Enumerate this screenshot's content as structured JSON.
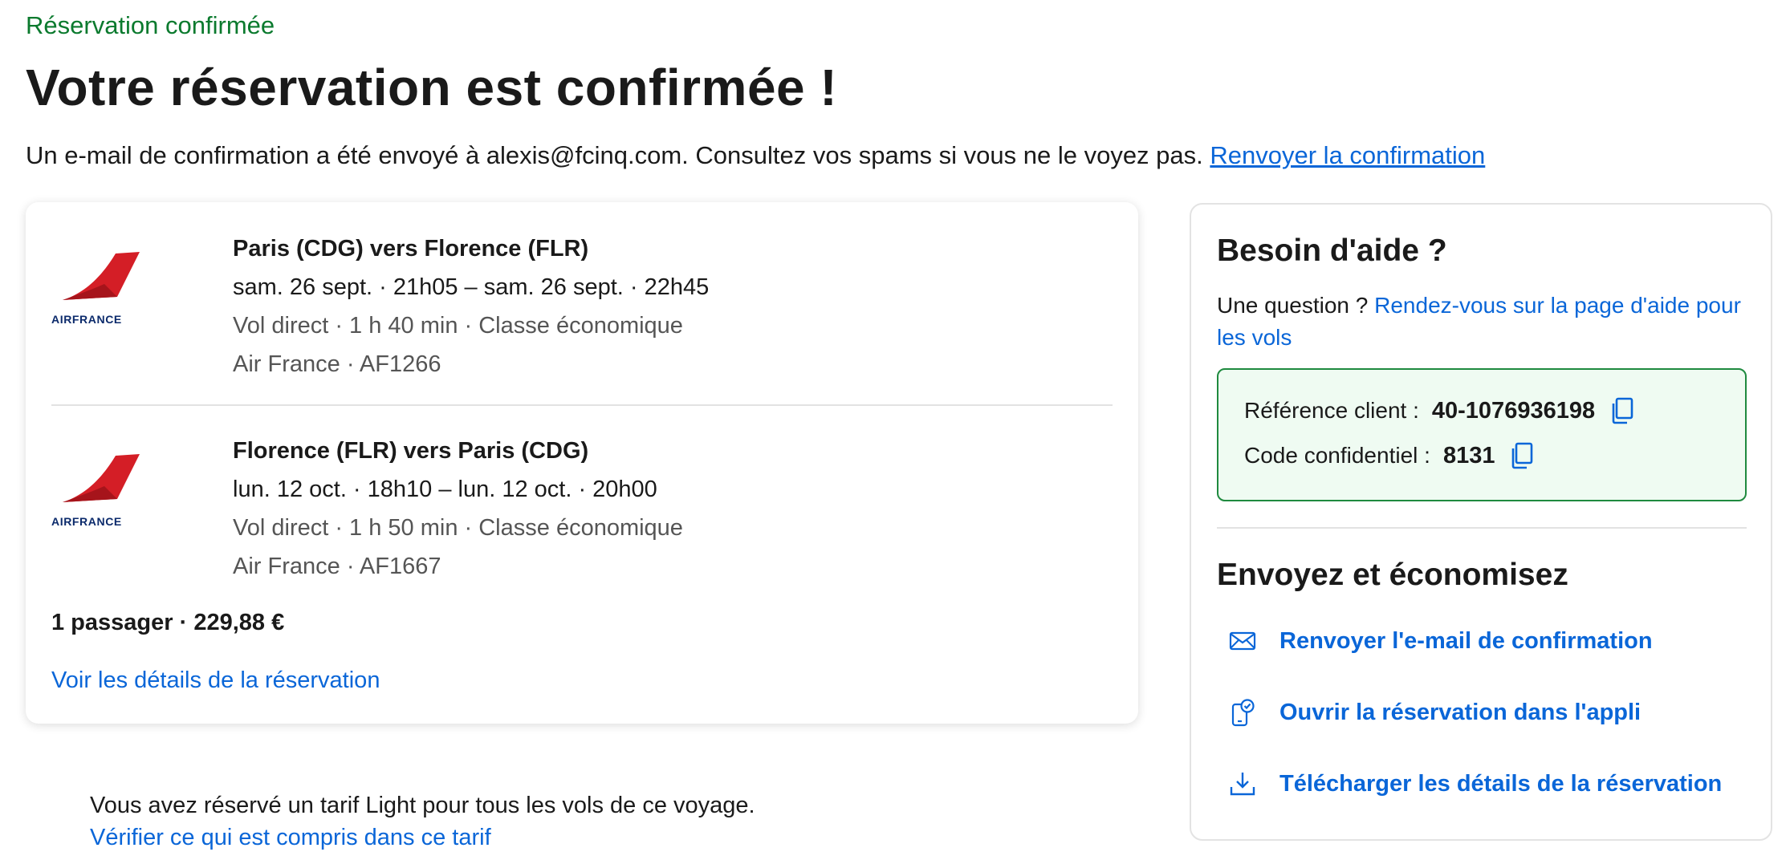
{
  "status": "Réservation confirmée",
  "title": "Votre réservation est confirmée !",
  "subtitle": {
    "text": "Un e-mail de confirmation a été envoyé à alexis@fcinq.com. Consultez vos spams si vous ne le voyez pas.",
    "link": "Renvoyer la confirmation"
  },
  "flights": [
    {
      "airline_logo": "AIRFRANCE",
      "route": "Paris (CDG) vers Florence (FLR)",
      "times": "sam. 26 sept. · 21h05 – sam. 26 sept. · 22h45",
      "detail": "Vol direct · 1 h 40 min · Classe économique",
      "carrier": "Air France · AF1266"
    },
    {
      "airline_logo": "AIRFRANCE",
      "route": "Florence (FLR) vers Paris (CDG)",
      "times": "lun. 12 oct. · 18h10 – lun. 12 oct. · 20h00",
      "detail": "Vol direct · 1 h 50 min · Classe économique",
      "carrier": "Air France · AF1667"
    }
  ],
  "summary": {
    "price": "1 passager · 229,88 €",
    "details_link": "Voir les détails de la réservation"
  },
  "fare_note": {
    "text": "Vous avez réservé un tarif Light pour tous les vols de ce voyage.",
    "link": "Vérifier ce qui est compris dans ce tarif"
  },
  "help": {
    "title": "Besoin d'aide ?",
    "question": "Une question ?",
    "link": "Rendez-vous sur la page d'aide pour les vols",
    "reference_label": "Référence client :",
    "reference_value": "40-1076936198",
    "code_label": "Code confidentiel :",
    "code_value": "8131"
  },
  "actions": {
    "title": "Envoyez et économisez",
    "items": [
      {
        "label": "Renvoyer l'e-mail de confirmation",
        "icon": "envelope-icon"
      },
      {
        "label": "Ouvrir la réservation dans l'appli",
        "icon": "phone-check-icon"
      },
      {
        "label": "Télécharger les détails de la réservation",
        "icon": "download-icon"
      }
    ]
  },
  "colors": {
    "accent_link": "#0a66d8",
    "success_green": "#0b7a2e",
    "box_background": "#effbf2",
    "airfrance_red": "#d41e26",
    "airfrance_navy": "#0b2a6b"
  }
}
